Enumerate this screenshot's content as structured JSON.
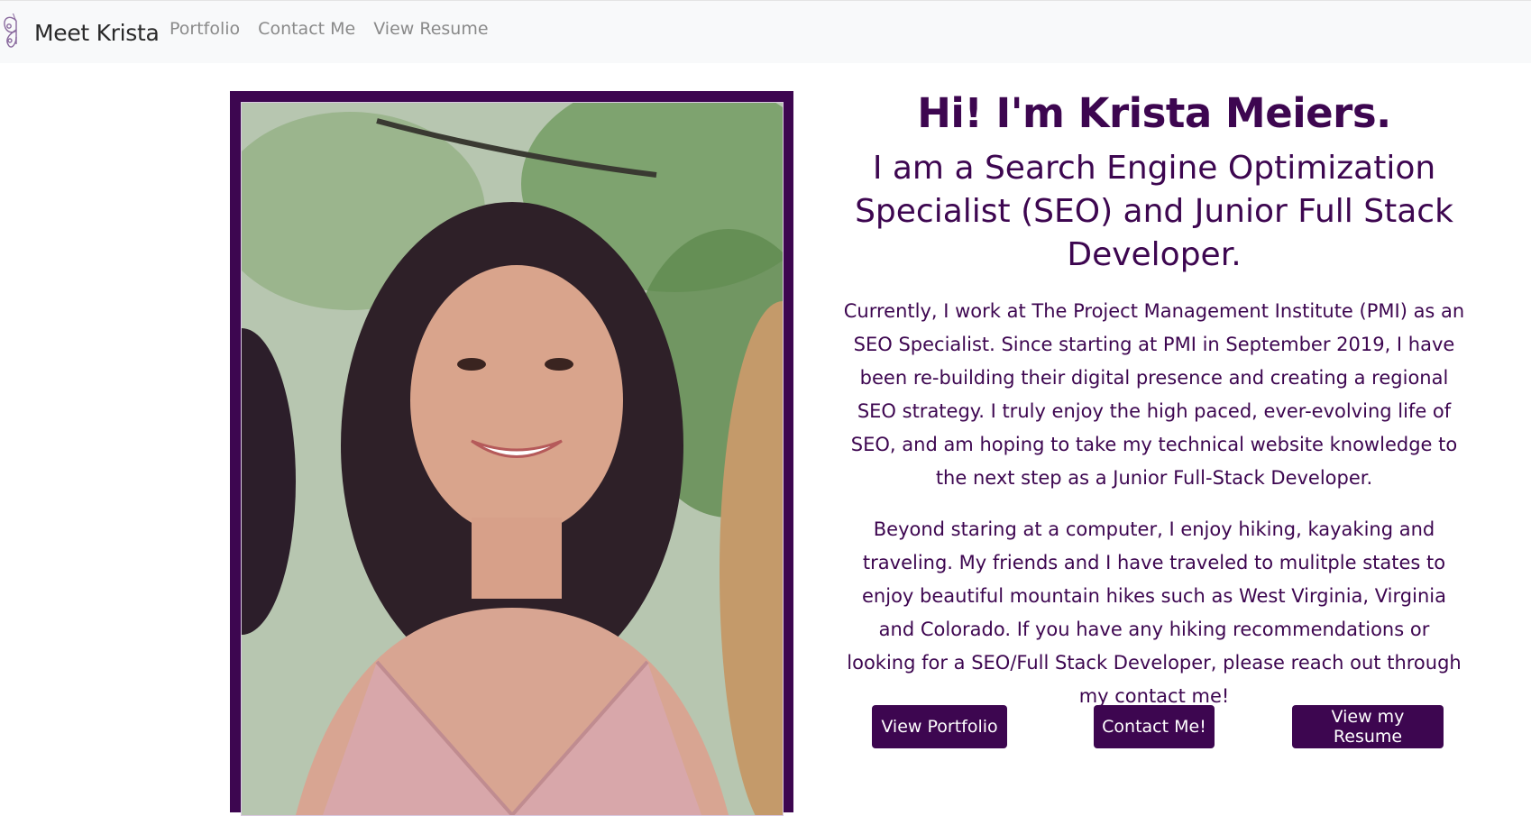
{
  "nav": {
    "brand": "Meet Krista",
    "brand_logo": "butterfly-icon",
    "links": [
      "Portfolio",
      "Contact Me",
      "View Resume"
    ]
  },
  "hero": {
    "photo": "portrait-photo",
    "frame_color": "#3d0650"
  },
  "intro": {
    "title": "Hi! I'm Krista Meiers.",
    "subtitle": "I am a Search Engine Optimization Specialist (SEO) and Junior Full Stack Developer.",
    "paragraph1": "Currently, I work at The Project Management Institute (PMI) as an SEO Specialist. Since starting at PMI in September 2019, I have been re-building their digital presence and creating a regional SEO strategy. I truly enjoy the high paced, ever-evolving life of SEO, and am hoping to take my technical website knowledge to the next step as a Junior Full-Stack Developer.",
    "paragraph2": "Beyond staring at a computer, I enjoy hiking, kayaking and traveling. My friends and I have traveled to mulitple states to enjoy beautiful mountain hikes such as West Virginia, Virginia and Colorado. If you have any hiking recommendations or looking for a SEO/Full Stack Developer, please reach out through my contact me!"
  },
  "buttons": {
    "portfolio": "View Portfolio",
    "contact": "Contact Me!",
    "resume": "View my Resume"
  },
  "colors": {
    "accent": "#3d0650",
    "navbar_bg": "#f8f9fa"
  }
}
